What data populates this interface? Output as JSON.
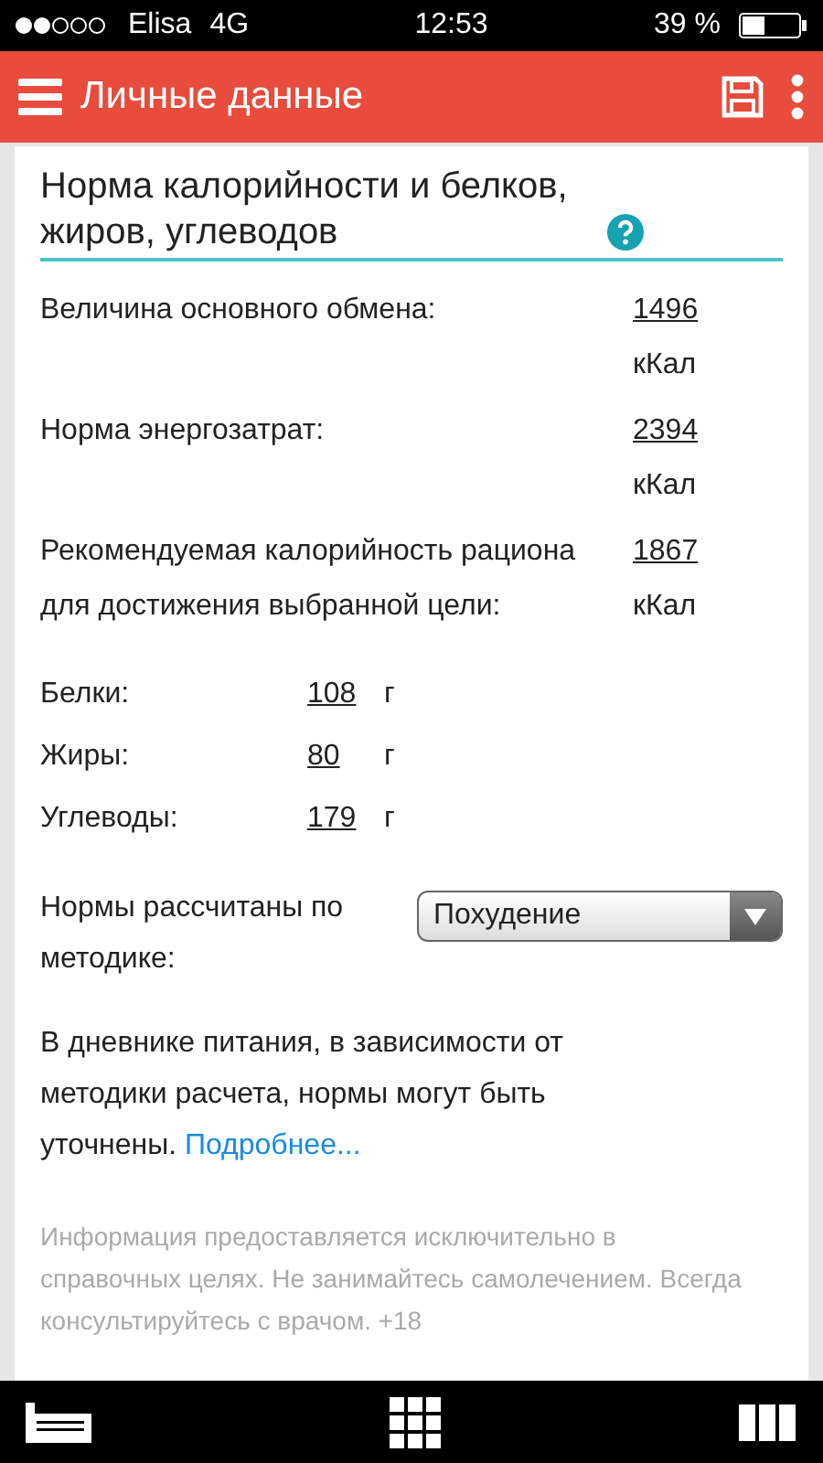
{
  "status_bar": {
    "carrier": "Elisa",
    "network": "4G",
    "time": "12:53",
    "battery": "39 %"
  },
  "header": {
    "title": "Личные данные"
  },
  "card": {
    "title": "Норма калорийности и белков, жиров, углеводов",
    "energy": [
      {
        "label": "Величина основного обмена:",
        "value": "1496",
        "unit": "кКал"
      },
      {
        "label": "Норма энергозатрат:",
        "value": "2394",
        "unit": "кКал"
      },
      {
        "label": "Рекомендуемая калорийность рациона для достижения выбранной цели:",
        "value": "1867",
        "unit": "кКал"
      }
    ],
    "macros": [
      {
        "label": "Белки:",
        "value": "108",
        "unit": "г"
      },
      {
        "label": "Жиры:",
        "value": "80",
        "unit": "г"
      },
      {
        "label": "Углеводы:",
        "value": "179",
        "unit": "г"
      }
    ],
    "method": {
      "label": "Нормы рассчитаны по методике:",
      "value": "Похудение"
    },
    "note": {
      "text": "В дневнике питания, в зависимости от методики расчета, нормы могут быть уточнены.",
      "link": "Подробнее..."
    },
    "disclaimer": "Информация предоставляется исключительно в справочных целях. Не занимайтесь самолечением. Всегда консультируйтесь с врачом. +18"
  }
}
